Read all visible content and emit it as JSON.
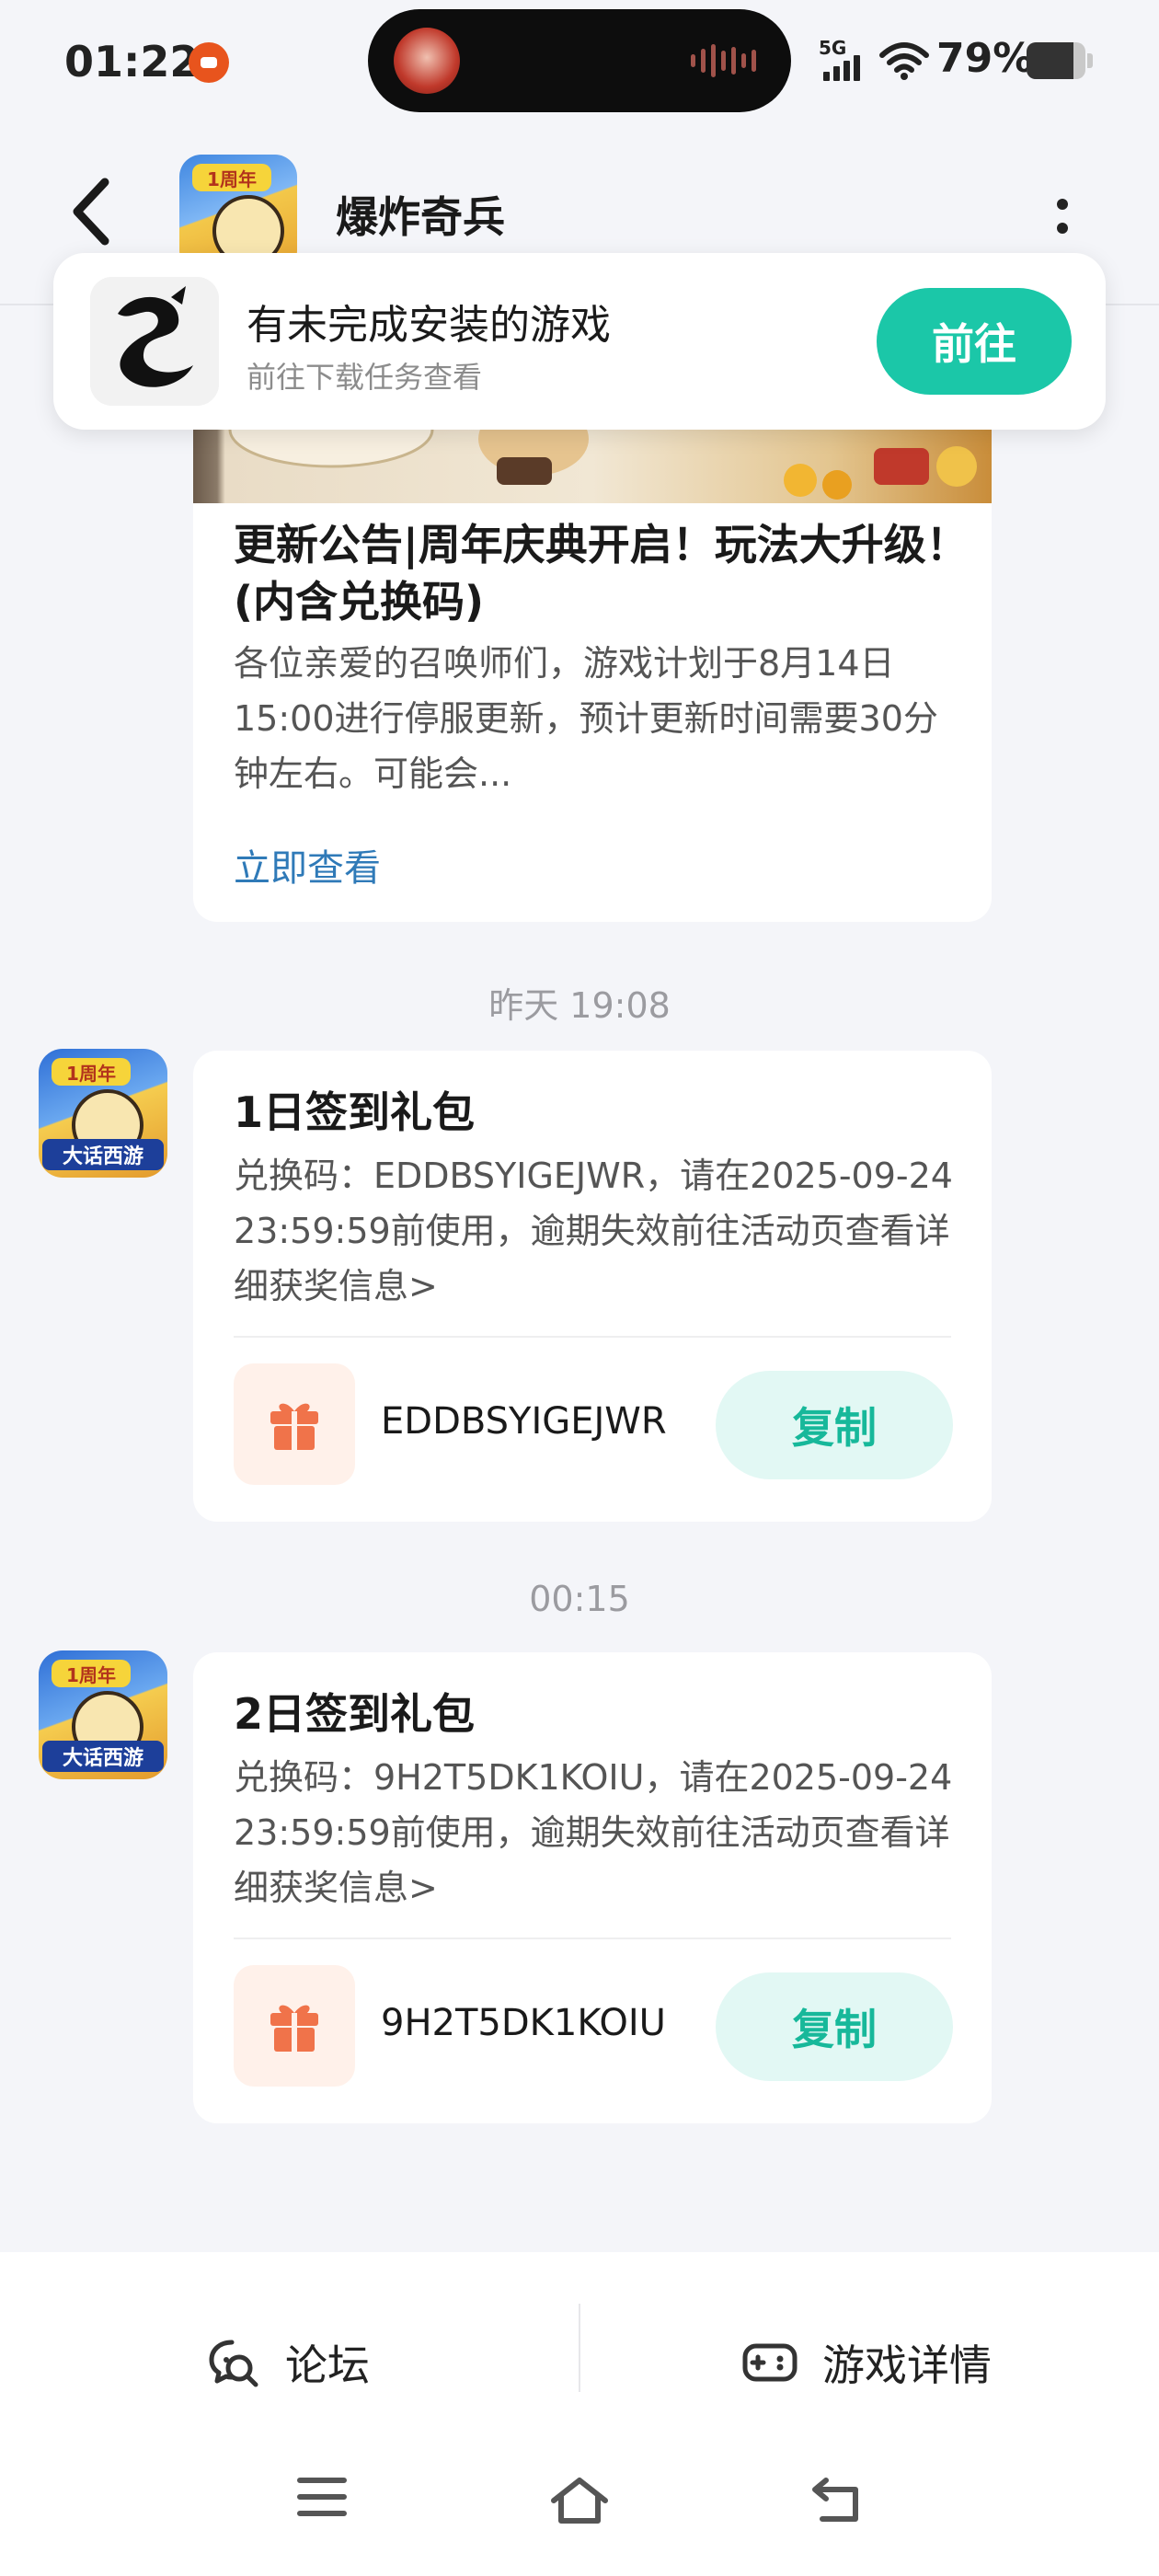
{
  "status_bar": {
    "time": "01:22",
    "network": "5G",
    "battery": "79%",
    "battery_level": 0.79
  },
  "header": {
    "title": "爆炸奇兵",
    "back_icon": "chevron-left-icon",
    "more_icon": "vertical-dots-icon"
  },
  "popup": {
    "title": "有未完成安装的游戏",
    "subtitle": "前往下载任务查看",
    "button": "前往"
  },
  "app_icon": {
    "badge": "1周年",
    "caption": "大话西游"
  },
  "messages": [
    {
      "title": "更新公告|周年庆典开启！玩法大升级！(内含兑换码)",
      "text": "各位亲爱的召唤师们，游戏计划于8月14日15:00进行停服更新，预计更新时间需要30分钟左右。可能会...",
      "link": "立即查看"
    },
    {
      "timestamp": "昨天 19:08",
      "title": "1日签到礼包",
      "text": "兑换码：EDDBSYIGEJWR，请在2025-09-24 23:59:59前使用，逾期失效前往活动页查看详细获奖信息>",
      "code": "EDDBSYIGEJWR",
      "copy": "复制"
    },
    {
      "timestamp": "00:15",
      "title": "2日签到礼包",
      "text": "兑换码：9H2T5DK1KOIU，请在2025-09-24 23:59:59前使用，逾期失效前往活动页查看详细获奖信息>",
      "code": "9H2T5DK1KOIU",
      "copy": "复制"
    }
  ],
  "bottom_bar": {
    "forum": "论坛",
    "game_details": "游戏详情"
  },
  "colors": {
    "accent": "#1bc7a8",
    "link": "#2f7ab8",
    "gift_bg": "#fff1ea",
    "gift": "#f0734a"
  }
}
